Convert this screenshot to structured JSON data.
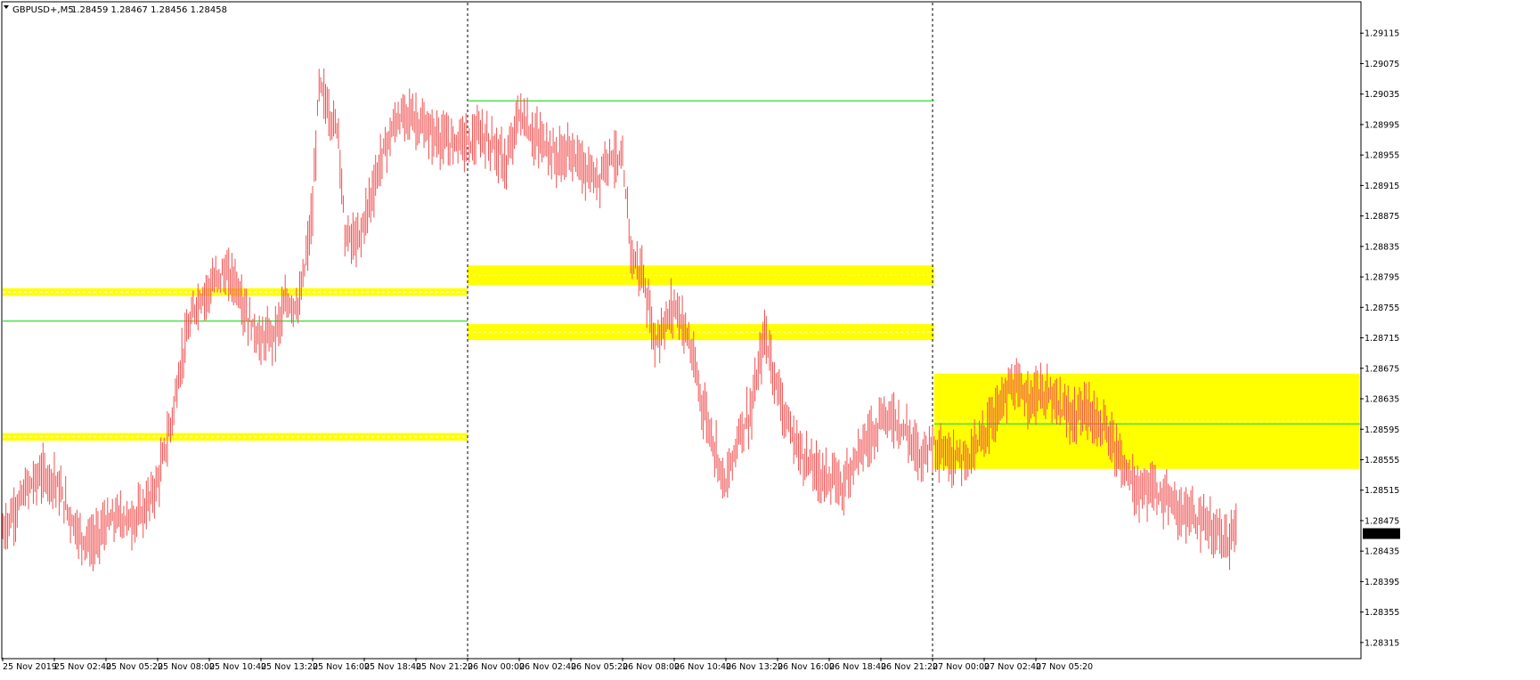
{
  "header": {
    "symbol": "GBPUSD+,M5",
    "ohlc": "1.28459 1.28467 1.28456 1.28458"
  },
  "colors": {
    "background": "#ffffff",
    "candle": "#f05050",
    "zone": "#ffff00",
    "green_line": "#33dd33",
    "zone_dash": "#ffffff",
    "separator": "#000000",
    "price_tag_bg": "#000000",
    "price_tag_text": "#ffffff"
  },
  "chart_data": {
    "type": "line",
    "title": "GBPUSD+,M5",
    "xlabel": "",
    "ylabel": "",
    "ylim": [
      1.28295,
      1.29155
    ],
    "y_ticks": [
      "1.29115",
      "1.29075",
      "1.29035",
      "1.28995",
      "1.28955",
      "1.28915",
      "1.28875",
      "1.28835",
      "1.28795",
      "1.28755",
      "1.28715",
      "1.28675",
      "1.28635",
      "1.28595",
      "1.28555",
      "1.28515",
      "1.28475",
      "1.28435",
      "1.28395",
      "1.28355",
      "1.28315"
    ],
    "x_ticks": [
      "25 Nov 2019",
      "25 Nov 02:40",
      "25 Nov 05:20",
      "25 Nov 08:00",
      "25 Nov 10:40",
      "25 Nov 13:20",
      "25 Nov 16:00",
      "25 Nov 18:40",
      "25 Nov 21:20",
      "26 Nov 00:00",
      "26 Nov 02:40",
      "26 Nov 05:20",
      "26 Nov 08:00",
      "26 Nov 10:40",
      "26 Nov 13:20",
      "26 Nov 16:00",
      "26 Nov 18:40",
      "26 Nov 21:20",
      "27 Nov 00:00",
      "27 Nov 02:40",
      "27 Nov 05:20"
    ],
    "x_tick_index": [
      0,
      32,
      64,
      96,
      128,
      160,
      192,
      224,
      256,
      288,
      320,
      352,
      384,
      416,
      448,
      480,
      512,
      544,
      576,
      608,
      640
    ],
    "current_price": "1.28458",
    "day_separators": [
      288,
      576
    ],
    "price_path": [
      [
        0,
        1.2846
      ],
      [
        8,
        1.2849
      ],
      [
        16,
        1.2852
      ],
      [
        24,
        1.28535
      ],
      [
        32,
        1.2853
      ],
      [
        40,
        1.2849
      ],
      [
        48,
        1.28455
      ],
      [
        56,
        1.28445
      ],
      [
        64,
        1.2847
      ],
      [
        72,
        1.2848
      ],
      [
        80,
        1.28475
      ],
      [
        88,
        1.2849
      ],
      [
        96,
        1.28525
      ],
      [
        104,
        1.286
      ],
      [
        112,
        1.287
      ],
      [
        120,
        1.2876
      ],
      [
        128,
        1.2878
      ],
      [
        136,
        1.288
      ],
      [
        144,
        1.2879
      ],
      [
        152,
        1.2874
      ],
      [
        160,
        1.2871
      ],
      [
        168,
        1.2872
      ],
      [
        176,
        1.2876
      ],
      [
        184,
        1.2876
      ],
      [
        192,
        1.2888
      ],
      [
        196,
        1.2905
      ],
      [
        204,
        1.29
      ],
      [
        208,
        1.2899
      ],
      [
        212,
        1.2885
      ],
      [
        220,
        1.2884
      ],
      [
        228,
        1.289
      ],
      [
        236,
        1.2896
      ],
      [
        244,
        1.29
      ],
      [
        252,
        1.2901
      ],
      [
        260,
        1.2899
      ],
      [
        268,
        1.2898
      ],
      [
        276,
        1.2897
      ],
      [
        284,
        1.2898
      ],
      [
        288,
        1.2897
      ],
      [
        296,
        1.2898
      ],
      [
        304,
        1.2897
      ],
      [
        312,
        1.2894
      ],
      [
        320,
        1.2901
      ],
      [
        328,
        1.2898
      ],
      [
        336,
        1.2897
      ],
      [
        344,
        1.2895
      ],
      [
        352,
        1.2896
      ],
      [
        360,
        1.28935
      ],
      [
        368,
        1.2892
      ],
      [
        376,
        1.2896
      ],
      [
        384,
        1.2894
      ],
      [
        390,
        1.2882
      ],
      [
        396,
        1.288
      ],
      [
        404,
        1.2871
      ],
      [
        412,
        1.2874
      ],
      [
        416,
        1.2876
      ],
      [
        424,
        1.2872
      ],
      [
        432,
        1.2864
      ],
      [
        440,
        1.2858
      ],
      [
        448,
        1.2852
      ],
      [
        456,
        1.2859
      ],
      [
        464,
        1.2862
      ],
      [
        472,
        1.2872
      ],
      [
        480,
        1.2865
      ],
      [
        488,
        1.2859
      ],
      [
        496,
        1.2856
      ],
      [
        504,
        1.2854
      ],
      [
        512,
        1.2853
      ],
      [
        520,
        1.2852
      ],
      [
        528,
        1.2856
      ],
      [
        536,
        1.2858
      ],
      [
        544,
        1.2861
      ],
      [
        552,
        1.2861
      ],
      [
        560,
        1.2859
      ],
      [
        568,
        1.2856
      ],
      [
        576,
        1.2858
      ],
      [
        584,
        1.2856
      ],
      [
        592,
        1.2856
      ],
      [
        600,
        1.2856
      ],
      [
        608,
        1.2859
      ],
      [
        616,
        1.2862
      ],
      [
        624,
        1.2865
      ],
      [
        632,
        1.2864
      ],
      [
        640,
        1.2864
      ],
      [
        648,
        1.2864
      ],
      [
        656,
        1.2862
      ],
      [
        664,
        1.2861
      ],
      [
        672,
        1.2862
      ],
      [
        680,
        1.286
      ],
      [
        688,
        1.2858
      ],
      [
        696,
        1.2854
      ],
      [
        704,
        1.2851
      ],
      [
        712,
        1.2852
      ],
      [
        720,
        1.285
      ],
      [
        728,
        1.2849
      ],
      [
        736,
        1.2848
      ],
      [
        744,
        1.2847
      ],
      [
        752,
        1.2846
      ],
      [
        760,
        1.2845
      ],
      [
        764,
        1.28458
      ]
    ],
    "horizontal_lines": [
      {
        "price": 1.28737,
        "from": 0,
        "to": 288
      },
      {
        "price": 1.29026,
        "from": 288,
        "to": 577
      },
      {
        "price": 1.28602,
        "from": 577,
        "to": 843
      }
    ],
    "zones": [
      {
        "top": 1.2878,
        "bottom": 1.2877,
        "from": 0,
        "to": 288
      },
      {
        "top": 1.2859,
        "bottom": 1.2858,
        "from": 0,
        "to": 288
      },
      {
        "top": 1.2881,
        "bottom": 1.28784,
        "from": 288,
        "to": 577
      },
      {
        "top": 1.28733,
        "bottom": 1.28712,
        "from": 288,
        "to": 577
      },
      {
        "top": 1.28668,
        "bottom": 1.28543,
        "from": 577,
        "to": 843
      }
    ]
  }
}
